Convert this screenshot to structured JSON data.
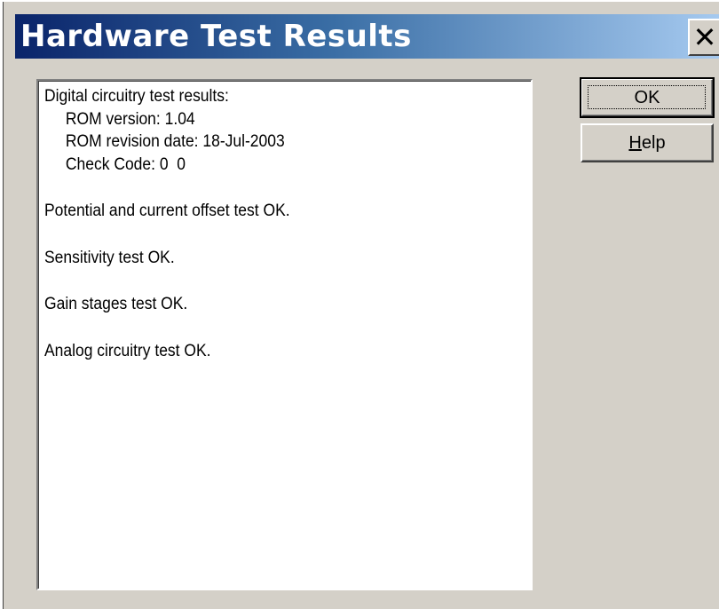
{
  "window": {
    "title": "Hardware Test Results",
    "close_glyph": "✕",
    "close_icon": "close-icon"
  },
  "results": {
    "lines": [
      {
        "text": "Digital circuitry test results:",
        "indent": false
      },
      {
        "text": "ROM version: 1.04",
        "indent": true
      },
      {
        "text": "ROM revision date: 18-Jul-2003",
        "indent": true
      },
      {
        "text": "Check Code: 0  0",
        "indent": true
      },
      {
        "text": "",
        "indent": false
      },
      {
        "text": "Potential and current offset test OK.",
        "indent": false
      },
      {
        "text": "",
        "indent": false
      },
      {
        "text": "Sensitivity test OK.",
        "indent": false
      },
      {
        "text": "",
        "indent": false
      },
      {
        "text": "Gain stages test OK.",
        "indent": false
      },
      {
        "text": "",
        "indent": false
      },
      {
        "text": "Analog circuitry test OK.",
        "indent": false
      }
    ]
  },
  "buttons": {
    "ok_label": "OK",
    "help_mnemonic": "H",
    "help_rest": "elp"
  },
  "colors": {
    "title_gradient_start": "#0a246a",
    "title_gradient_end": "#a6caf0",
    "dialog_face": "#d4d0c8"
  }
}
